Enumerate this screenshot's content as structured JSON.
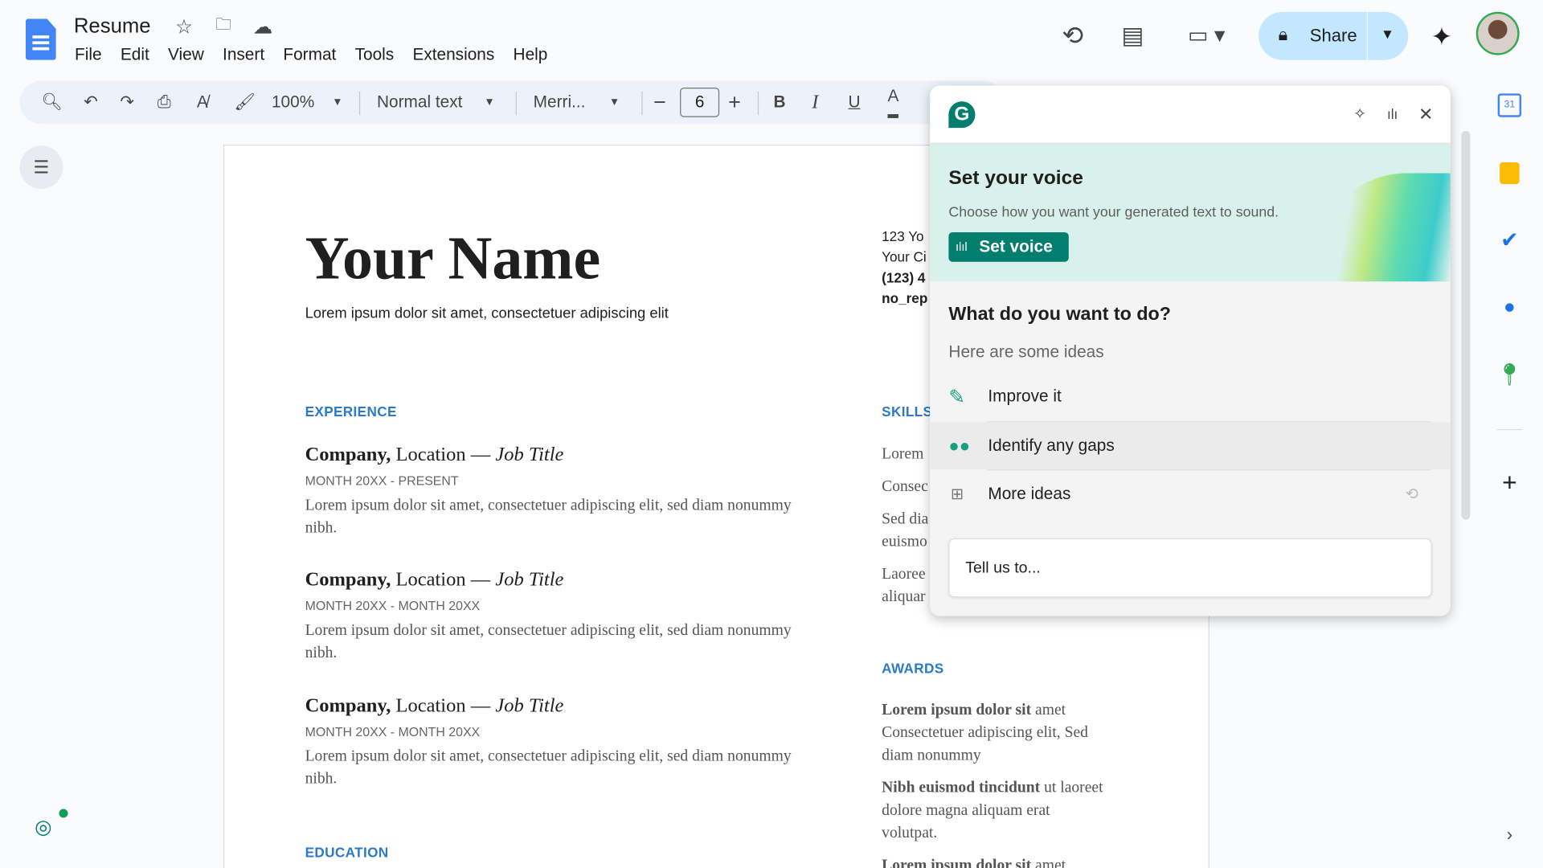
{
  "app": {
    "title": "Resume",
    "menu": [
      "File",
      "Edit",
      "View",
      "Insert",
      "Format",
      "Tools",
      "Extensions",
      "Help"
    ],
    "share_label": "Share"
  },
  "toolbar": {
    "zoom": "100%",
    "style": "Normal text",
    "font": "Merri...",
    "font_size": "6",
    "bold": "B",
    "italic": "I",
    "underline": "U",
    "text_color": "A"
  },
  "doc": {
    "name": "Your Name",
    "tagline": "Lorem ipsum dolor sit amet, consectetuer adipiscing elit",
    "contact": [
      "123 Yo",
      "Your Ci",
      "(123) 4",
      "no_rep"
    ],
    "experience_heading": "EXPERIENCE",
    "jobs": [
      {
        "company": "Company,",
        "location": " Location — ",
        "title": "Job Title",
        "dates": "MONTH 20XX - PRESENT",
        "desc": "Lorem ipsum dolor sit amet, consectetuer adipiscing elit, sed diam nonummy nibh."
      },
      {
        "company": "Company,",
        "location": " Location — ",
        "title": "Job Title",
        "dates": "MONTH 20XX - MONTH 20XX",
        "desc": "Lorem ipsum dolor sit amet, consectetuer adipiscing elit, sed diam nonummy nibh."
      },
      {
        "company": "Company,",
        "location": " Location — ",
        "title": "Job Title",
        "dates": "MONTH 20XX - MONTH 20XX",
        "desc": "Lorem ipsum dolor sit amet, consectetuer adipiscing elit, sed diam nonummy nibh."
      }
    ],
    "education_heading": "EDUCATION",
    "skills_heading": "SKILLS",
    "skills": [
      "Lorem",
      "Consec",
      "Sed dia",
      "euismo",
      "Laoree",
      "aliquar"
    ],
    "awards_heading": "AWARDS",
    "awards": [
      {
        "bold": "Lorem ipsum dolor sit",
        "rest": " amet Consectetuer adipiscing elit, Sed diam nonummy"
      },
      {
        "bold": "Nibh euismod tincidunt",
        "rest": " ut laoreet dolore magna aliquam erat volutpat."
      },
      {
        "bold": "Lorem ipsum dolor sit",
        "rest": " amet"
      }
    ]
  },
  "grammarly": {
    "voice_title": "Set your voice",
    "voice_desc": "Choose how you want your generated text to sound.",
    "voice_button": "Set voice",
    "question": "What do you want to do?",
    "ideas_label": "Here are some ideas",
    "items": [
      {
        "label": "Improve it",
        "icon": "pencil-sparkle-icon"
      },
      {
        "label": "Identify any gaps",
        "icon": "binoculars-icon"
      },
      {
        "label": "More ideas",
        "icon": "grid-sparkle-icon"
      }
    ],
    "input_placeholder": "Tell us to...",
    "brand_color": "#027e6f",
    "banner_color": "#d8f1ea"
  }
}
